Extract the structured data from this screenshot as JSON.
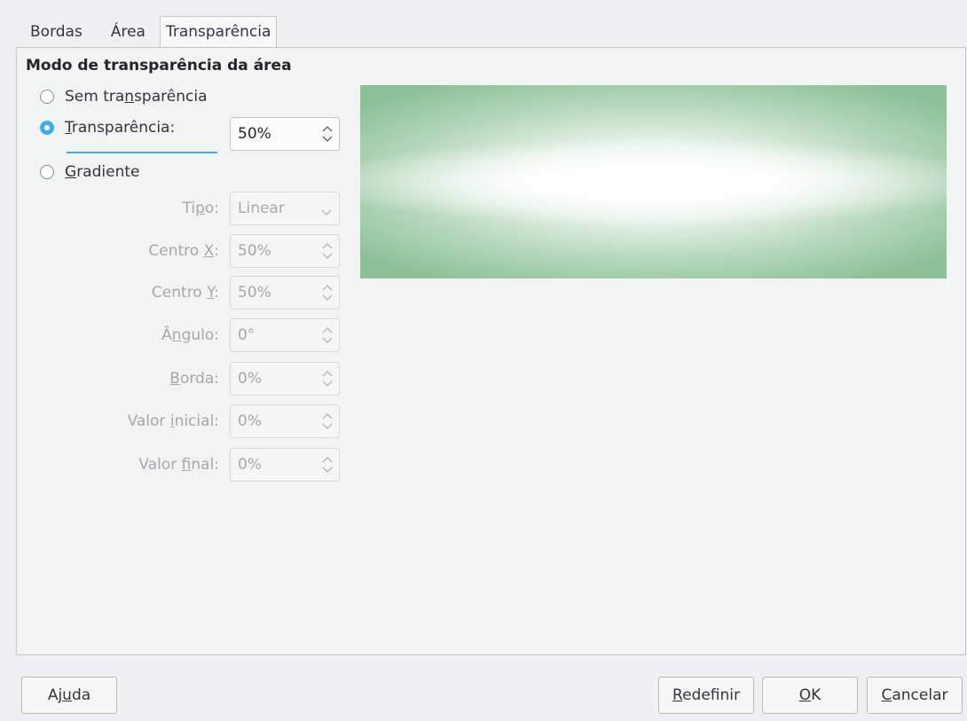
{
  "tabs": [
    {
      "label": "Bordas"
    },
    {
      "label": "Área"
    },
    {
      "label": "Transparência",
      "active": true
    }
  ],
  "section": {
    "title": "Modo de transparência da área"
  },
  "modes": {
    "none": {
      "pre": "Sem tra",
      "u": "n",
      "post": "sparência",
      "checked": false
    },
    "transparency": {
      "pre": "",
      "u": "T",
      "post": "ransparência:",
      "checked": true,
      "value": "50%"
    },
    "gradient": {
      "pre": "",
      "u": "G",
      "post": "radiente",
      "checked": false
    }
  },
  "gradient_fields": {
    "type": {
      "pre": "Ti",
      "u": "p",
      "post": "o:",
      "value": "Linear"
    },
    "center_x": {
      "pre": "Centro ",
      "u": "X",
      "post": ":",
      "value": "50%"
    },
    "center_y": {
      "pre": "Centro ",
      "u": "Y",
      "post": ":",
      "value": "50%"
    },
    "angle": {
      "pre": "Â",
      "u": "n",
      "post": "gulo:",
      "value": "0°"
    },
    "border": {
      "pre": "",
      "u": "B",
      "post": "orda:",
      "value": "0%"
    },
    "start_value": {
      "pre": "Valor ",
      "u": "i",
      "post": "nicial:",
      "value": "0%"
    },
    "end_value": {
      "pre": "Valor ",
      "u": "f",
      "post": "inal:",
      "value": "0%"
    }
  },
  "buttons": {
    "help": {
      "pre": "Aj",
      "u": "u",
      "post": "da"
    },
    "reset": {
      "pre": "",
      "u": "R",
      "post": "edefinir"
    },
    "ok": {
      "pre": "",
      "u": "O",
      "post": "K"
    },
    "cancel": {
      "pre": "",
      "u": "C",
      "post": "ancelar"
    }
  },
  "colors": {
    "accent": "#3daee9",
    "preview_green": "#8cc198",
    "dialog_bg": "#eff0f1"
  }
}
